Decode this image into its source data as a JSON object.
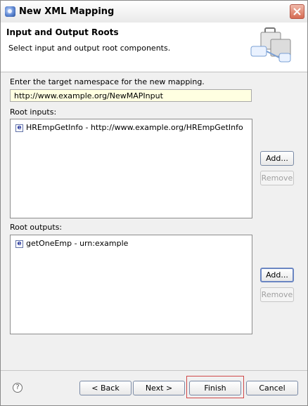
{
  "window": {
    "title": "New XML Mapping"
  },
  "header": {
    "title": "Input and Output Roots",
    "description": "Select input and output root components."
  },
  "namespace": {
    "label": "Enter the target namespace for the new mapping.",
    "value": "http://www.example.org/NewMAPInput"
  },
  "inputs": {
    "label": "Root inputs:",
    "items": [
      {
        "icon": "e",
        "text": "HREmpGetInfo - http://www.example.org/HREmpGetInfo"
      }
    ],
    "add_label": "Add...",
    "remove_label": "Remove"
  },
  "outputs": {
    "label": "Root outputs:",
    "items": [
      {
        "icon": "e",
        "text": "getOneEmp - urn:example"
      }
    ],
    "add_label": "Add...",
    "remove_label": "Remove"
  },
  "footer": {
    "help_icon": "?",
    "back_label": "< Back",
    "next_label": "Next >",
    "finish_label": "Finish",
    "cancel_label": "Cancel"
  }
}
